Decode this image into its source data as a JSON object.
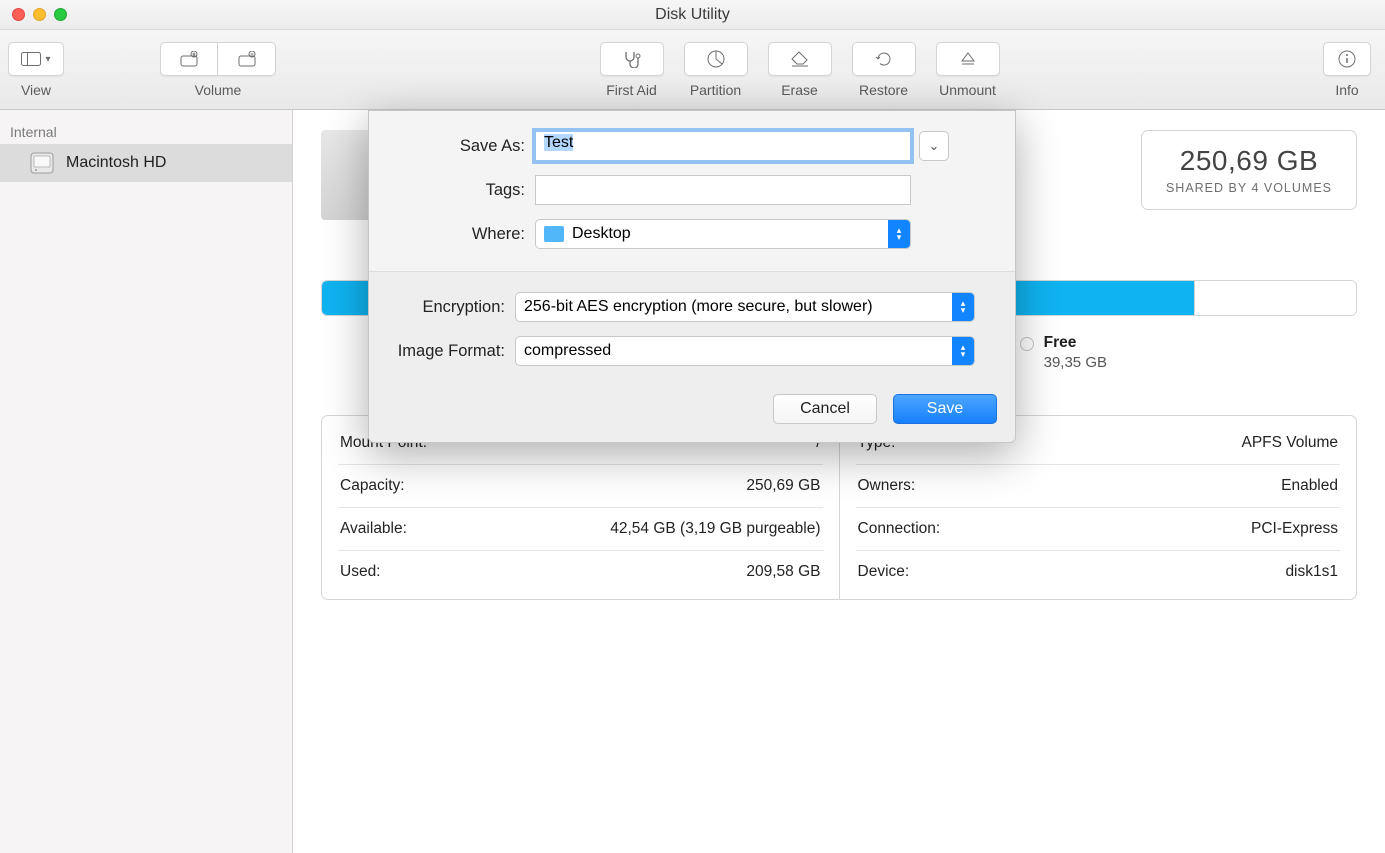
{
  "window": {
    "title": "Disk Utility"
  },
  "toolbar": {
    "view": "View",
    "volume": "Volume",
    "first_aid": "First Aid",
    "partition": "Partition",
    "erase": "Erase",
    "restore": "Restore",
    "unmount": "Unmount",
    "info": "Info"
  },
  "sidebar": {
    "internal_header": "Internal",
    "items": [
      {
        "label": "Macintosh HD"
      }
    ]
  },
  "disk": {
    "size": "250,69 GB",
    "shared_by": "SHARED BY 4 VOLUMES"
  },
  "legend": {
    "free_label": "Free",
    "free_value": "39,35 GB"
  },
  "info_left": [
    {
      "k": "Mount Point:",
      "v": "/"
    },
    {
      "k": "Capacity:",
      "v": "250,69 GB"
    },
    {
      "k": "Available:",
      "v": "42,54 GB (3,19 GB purgeable)"
    },
    {
      "k": "Used:",
      "v": "209,58 GB"
    }
  ],
  "info_right": [
    {
      "k": "Type:",
      "v": "APFS Volume"
    },
    {
      "k": "Owners:",
      "v": "Enabled"
    },
    {
      "k": "Connection:",
      "v": "PCI-Express"
    },
    {
      "k": "Device:",
      "v": "disk1s1"
    }
  ],
  "sheet": {
    "save_as_label": "Save As:",
    "save_as_value": "Test",
    "tags_label": "Tags:",
    "tags_value": "",
    "where_label": "Where:",
    "where_value": "Desktop",
    "encryption_label": "Encryption:",
    "encryption_value": "256-bit AES encryption (more secure, but slower)",
    "format_label": "Image Format:",
    "format_value": "compressed",
    "cancel": "Cancel",
    "save": "Save"
  }
}
